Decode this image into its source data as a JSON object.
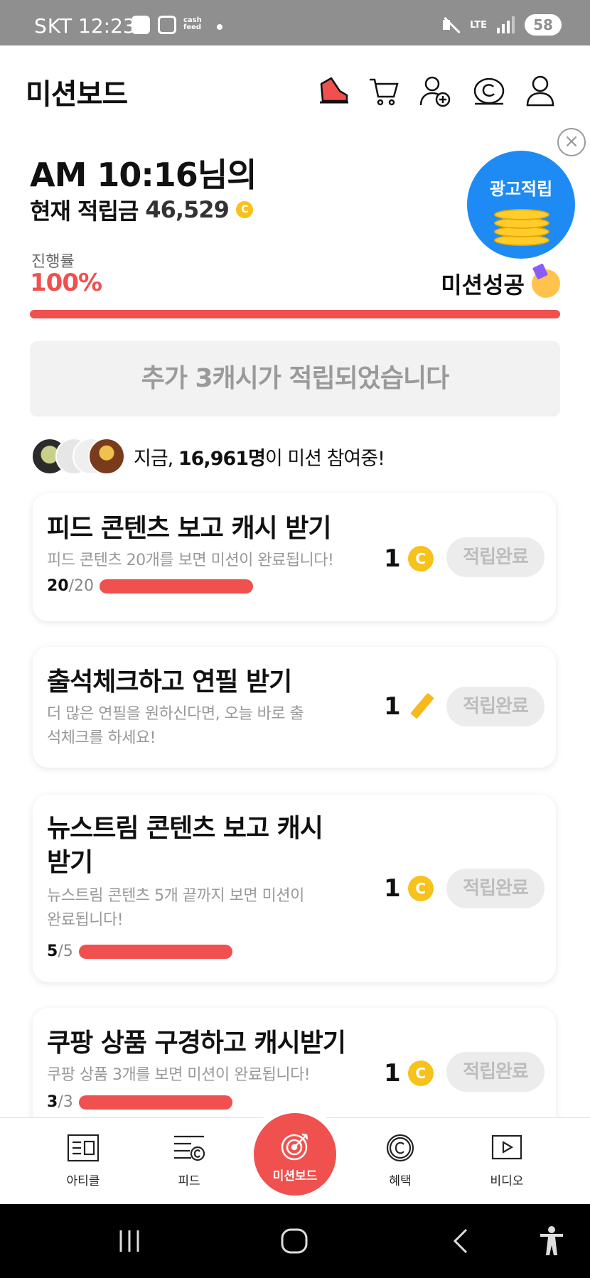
{
  "status_bar": {
    "carrier": "SKT",
    "time": "12:23",
    "cashfeed_icon_text": "cash feed",
    "network": "LTE",
    "battery": "58"
  },
  "header": {
    "title": "미션보드",
    "icons": [
      "sneaker-icon",
      "cart-icon",
      "add-friend-icon",
      "cash-c-icon",
      "profile-icon"
    ]
  },
  "summary": {
    "greeting": "AM 10:16님의",
    "balance_label": "현재 적립금",
    "balance_value": "46,529",
    "coin_symbol": "C",
    "progress_label": "진행률",
    "progress_value": "100%",
    "progress_fraction": 1.0,
    "success_label": "미션성공",
    "ad_badge_label": "광고적립"
  },
  "notice": {
    "text": "추가 3캐시가 적립되었습니다"
  },
  "participants": {
    "prefix": "지금, ",
    "count": "16,961명",
    "suffix": "이 미션 참여중!"
  },
  "missions": [
    {
      "title": "피드 콘텐츠 보고 캐시 받기",
      "desc": "피드 콘텐츠 20개를 보면 미션이 완료됩니다!",
      "count_done": "20",
      "count_total": "/20",
      "progress": 1.0,
      "reward": "1",
      "reward_type": "coin-icon",
      "button": "적립완료"
    },
    {
      "title": "출석체크하고 연필 받기",
      "desc": "더 많은 연필을 원하신다면, 오늘 바로 출석체크를 하세요!",
      "reward": "1",
      "reward_type": "pencil-icon",
      "button": "적립완료"
    },
    {
      "title": "뉴스트림 콘텐츠 보고 캐시 받기",
      "desc": "뉴스트림 콘텐츠 5개 끝까지 보면 미션이 완료됩니다!",
      "count_done": "5",
      "count_total": "/5",
      "progress": 1.0,
      "reward": "1",
      "reward_type": "coin-icon",
      "button": "적립완료"
    },
    {
      "title": "쿠팡 상품 구경하고 캐시받기",
      "desc": "쿠팡 상품 3개를 보면 미션이 완료됩니다!",
      "count_done": "3",
      "count_total": "/3",
      "progress": 1.0,
      "reward": "1",
      "reward_type": "coin-icon",
      "button": "적립완료"
    }
  ],
  "bottom_nav": {
    "items": [
      {
        "label": "아티클",
        "icon": "article-icon"
      },
      {
        "label": "피드",
        "icon": "feed-icon"
      },
      {
        "label": "미션보드",
        "icon": "target-icon"
      },
      {
        "label": "혜택",
        "icon": "benefit-c-icon"
      },
      {
        "label": "비디오",
        "icon": "video-play-icon"
      }
    ]
  },
  "colors": {
    "accent": "#f0504e",
    "coin": "#f6c21b",
    "ad_blue": "#1e8bf5",
    "status_bar": "#8f8f8f"
  }
}
